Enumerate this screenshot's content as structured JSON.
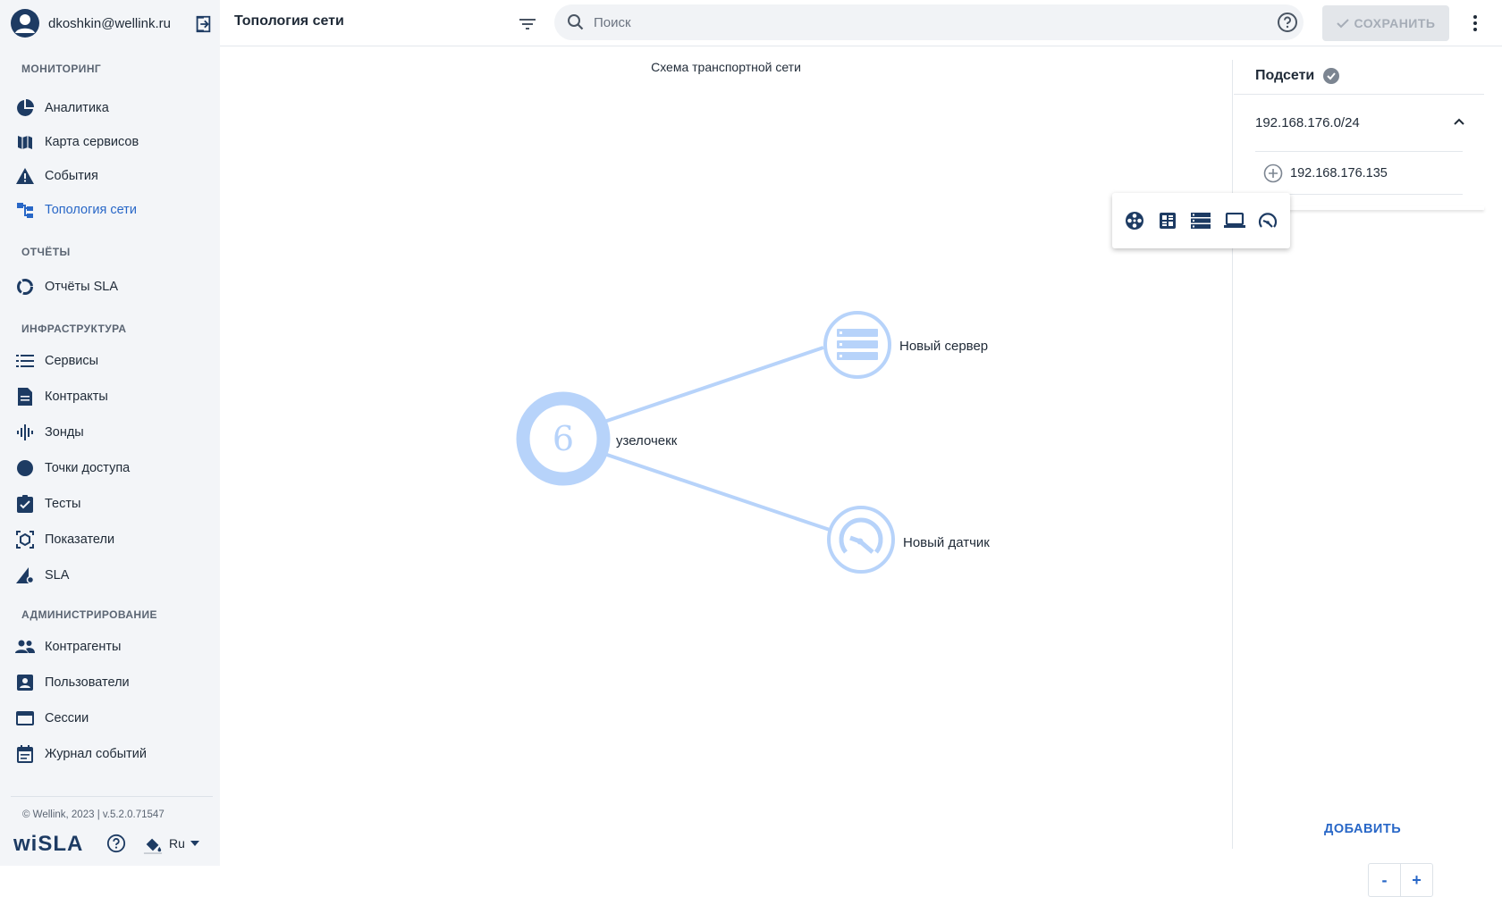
{
  "user": {
    "email": "dkoshkin@wellink.ru"
  },
  "sidebar": {
    "sections": [
      {
        "title": "МОНИТОРИНГ",
        "items": [
          {
            "label": "Аналитика",
            "icon": "pie-chart-icon"
          },
          {
            "label": "Карта сервисов",
            "icon": "map-icon"
          },
          {
            "label": "События",
            "icon": "warning-icon"
          },
          {
            "label": "Топология сети",
            "icon": "topology-icon",
            "active": true
          }
        ]
      },
      {
        "title": "ОТЧЁТЫ",
        "items": [
          {
            "label": "Отчёты SLA",
            "icon": "donut-icon"
          }
        ]
      },
      {
        "title": "ИНФРАСТРУКТУРА",
        "items": [
          {
            "label": "Сервисы",
            "icon": "list-icon"
          },
          {
            "label": "Контракты",
            "icon": "document-icon"
          },
          {
            "label": "Зонды",
            "icon": "probe-icon"
          },
          {
            "label": "Точки доступа",
            "icon": "circle-icon"
          },
          {
            "label": "Тесты",
            "icon": "clipboard-check-icon"
          },
          {
            "label": "Показатели",
            "icon": "metrics-icon"
          },
          {
            "label": "SLA",
            "icon": "sla-icon"
          }
        ]
      },
      {
        "title": "АДМИНИСТРИРОВАНИЕ",
        "items": [
          {
            "label": "Контрагенты",
            "icon": "people-icon"
          },
          {
            "label": "Пользователи",
            "icon": "user-card-icon"
          },
          {
            "label": "Сессии",
            "icon": "window-icon"
          },
          {
            "label": "Журнал событий",
            "icon": "calendar-icon"
          }
        ]
      }
    ],
    "copyright": "© Wellink, 2023 | v.5.2.0.71547",
    "logo": "wiSLA",
    "language": "Ru"
  },
  "header": {
    "title": "Топология сети",
    "search_placeholder": "Поиск",
    "save_label": "СОХРАНИТЬ"
  },
  "canvas": {
    "title": "Схема транспортной сети",
    "nodes": [
      {
        "id": "hub",
        "label": "узелочекк",
        "badge": "6",
        "icon": "cluster-icon"
      },
      {
        "id": "server",
        "label": "Новый сервер",
        "icon": "server-icon"
      },
      {
        "id": "sensor",
        "label": "Новый датчик",
        "icon": "gauge-icon"
      }
    ],
    "links": [
      [
        "hub",
        "server"
      ],
      [
        "hub",
        "sensor"
      ]
    ],
    "toolbar": [
      "hub-node-icon",
      "rack-icon",
      "server-icon",
      "laptop-icon",
      "gauge-icon"
    ],
    "zoom_out": "-",
    "zoom_in": "+"
  },
  "panel": {
    "title": "Подсети",
    "subnets": [
      {
        "label": "192.168.176.0/24",
        "expanded": true,
        "hosts": [
          "192.168.176.135"
        ]
      }
    ],
    "add_label": "ДОБАВИТЬ"
  },
  "colors": {
    "accent": "#2867c7",
    "node": "#b7d3fa",
    "sidebar_bg": "#f3f5f8",
    "icon_dark": "#1d3b63"
  }
}
